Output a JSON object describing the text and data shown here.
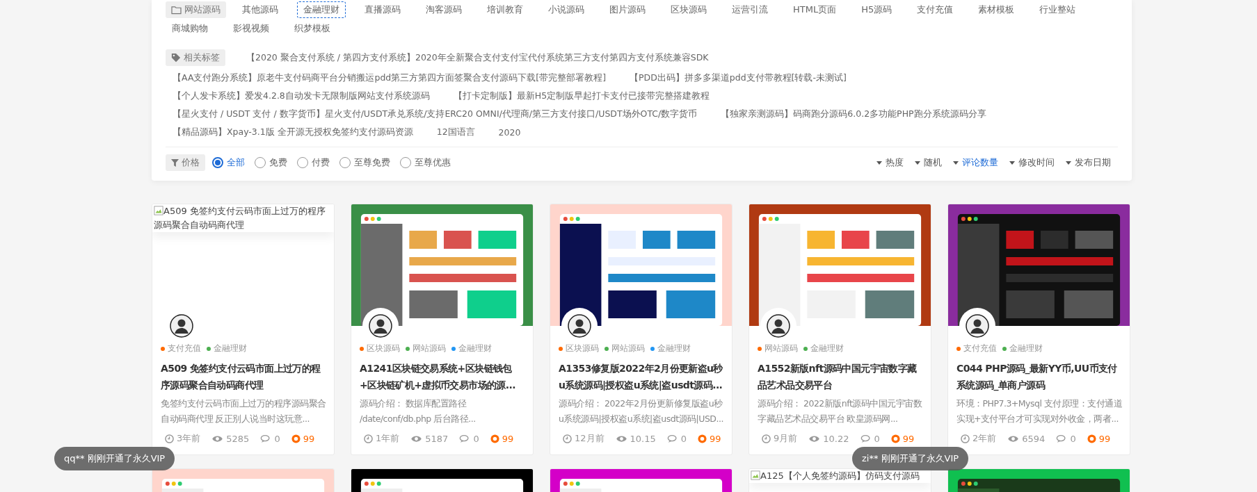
{
  "category_filter": {
    "label": "网站源码",
    "items": [
      {
        "label": "其他源码",
        "selected": false
      },
      {
        "label": "金融理财",
        "selected": true
      },
      {
        "label": "直播源码",
        "selected": false
      },
      {
        "label": "淘客源码",
        "selected": false
      },
      {
        "label": "培训教育",
        "selected": false
      },
      {
        "label": "小说源码",
        "selected": false
      },
      {
        "label": "图片源码",
        "selected": false
      },
      {
        "label": "区块源码",
        "selected": false
      },
      {
        "label": "运营引流",
        "selected": false
      },
      {
        "label": "HTML页面",
        "selected": false
      },
      {
        "label": "H5源码",
        "selected": false
      },
      {
        "label": "支付充值",
        "selected": false
      },
      {
        "label": "素材模板",
        "selected": false
      },
      {
        "label": "行业整站",
        "selected": false
      },
      {
        "label": "商城购物",
        "selected": false
      },
      {
        "label": "影视视频",
        "selected": false
      },
      {
        "label": "织梦模板",
        "selected": false
      }
    ]
  },
  "tag_filter": {
    "label": "相关标签",
    "tags": [
      "【2020 聚合支付系统 / 第四方支付系统】2020年全新聚合支付支付宝代付系统第三方支付第四方支付系统兼容SDK",
      "【AA支付跑分系统】原老牛支付码商平台分销搬运pdd第三方第四方面签聚合支付源码下载[带完整部署教程]",
      "【PDD出码】拼多多渠道pdd支付带教程[转载-未测试]",
      "【个人发卡系统】爱发4.2.8自动发卡无限制版网站支付系统源码",
      "【打卡定制版】最新H5定制版早起打卡支付已接带完整搭建教程",
      "【星火支付 / USDT 支付 / 数字货币】星火支付/USDT承兑系统/支持ERC20 OMNI/代理商/第三方支付接口/USDT场外OTC/数字货币",
      "【独家亲测源码】码商跑分源码6.0.2多功能PHP跑分系统源码分享",
      "【精品源码】Xpay-3.1版 全开源无授权免签约支付源码资源",
      "12国语言",
      "2020"
    ]
  },
  "price_filter": {
    "label": "价格",
    "options": [
      {
        "label": "全部",
        "selected": true
      },
      {
        "label": "免费",
        "selected": false
      },
      {
        "label": "付费",
        "selected": false
      },
      {
        "label": "至尊免费",
        "selected": false
      },
      {
        "label": "至尊优惠",
        "selected": false
      }
    ]
  },
  "sort_options": [
    {
      "label": "热度",
      "selected": false
    },
    {
      "label": "随机",
      "selected": false
    },
    {
      "label": "评论数量",
      "selected": true
    },
    {
      "label": "修改时间",
      "selected": false
    },
    {
      "label": "发布日期",
      "selected": false
    }
  ],
  "cards": [
    {
      "image": {
        "kind": "broken",
        "alt": "A509 免签约支付云码市面上过万的程序源码聚合自动码商代理"
      },
      "tags": [
        {
          "label": "支付充值",
          "color": "#ff6a00"
        },
        {
          "label": "金融理财",
          "color": "#4caf50"
        }
      ],
      "title": "A509 免签约支付云码市面上过万的程序源码聚合自动码商代理",
      "description": "免签约支付云码市面上过万的程序源码聚合自动码商代理 反正别人说当时这玩意...",
      "time": "3年前",
      "views": "5285",
      "comments": "0",
      "price": "99"
    },
    {
      "image": {
        "kind": "picture"
      },
      "tags": [
        {
          "label": "区块源码",
          "color": "#ff6a00"
        },
        {
          "label": "网站源码",
          "color": "#4caf50"
        },
        {
          "label": "金融理财",
          "color": "#2196f3"
        }
      ],
      "title": "A1241区块链交易系统+区块链钱包+区块链矿机+虚拟币交易市场的源...",
      "description": "源码介绍： 数据库配置路径 /date/conf/db.php 后台路径...",
      "time": "1年前",
      "views": "5187",
      "comments": "0",
      "price": "99"
    },
    {
      "image": {
        "kind": "picture"
      },
      "tags": [
        {
          "label": "区块源码",
          "color": "#ff6a00"
        },
        {
          "label": "网站源码",
          "color": "#4caf50"
        },
        {
          "label": "金融理财",
          "color": "#2196f3"
        }
      ],
      "title": "A1353修复版2022年2月份更新盗u秒u系统源码|授权盗u系统|盗usdt源码...",
      "description": "源码介绍： 2022年2月份更新修复版盗u秒u系统源码|授权盗u系统|盗usdt源码|USD...",
      "time": "12月前",
      "views": "10.15",
      "comments": "0",
      "price": "99"
    },
    {
      "image": {
        "kind": "picture"
      },
      "tags": [
        {
          "label": "网站源码",
          "color": "#ff6a00"
        },
        {
          "label": "金融理财",
          "color": "#4caf50"
        }
      ],
      "title": "A1552新版nft源码中国元宇宙数字藏品艺术品交易平台",
      "description": "源码介绍： 2022新版nft源码中国元宇宙数字藏品艺术品交易平台 欧皇源码网...",
      "time": "9月前",
      "views": "10.22",
      "comments": "0",
      "price": "99"
    },
    {
      "image": {
        "kind": "picture"
      },
      "tags": [
        {
          "label": "支付充值",
          "color": "#ff6a00"
        },
        {
          "label": "金融理财",
          "color": "#4caf50"
        }
      ],
      "title": "C044 PHP源码_最新YY币,UU币支付系统源码_单商户源码",
      "description": "环境：PHP7.3+Mysql 支付原理：支付通道实现+支付平台才可实现对外收金，两者...",
      "time": "2年前",
      "views": "6594",
      "comments": "0",
      "price": "99"
    },
    {
      "image": {
        "kind": "picture"
      }
    },
    {
      "image": {
        "kind": "picture"
      }
    },
    {
      "image": {
        "kind": "picture"
      }
    },
    {
      "image": {
        "kind": "broken",
        "alt": "A125【个人免签约源码】仿码支付源码"
      }
    },
    {
      "image": {
        "kind": "picture"
      }
    }
  ],
  "toasts": [
    {
      "text": "qq** 刚刚开通了永久VIP"
    },
    {
      "text": "zi** 刚刚开通了永久VIP"
    }
  ]
}
